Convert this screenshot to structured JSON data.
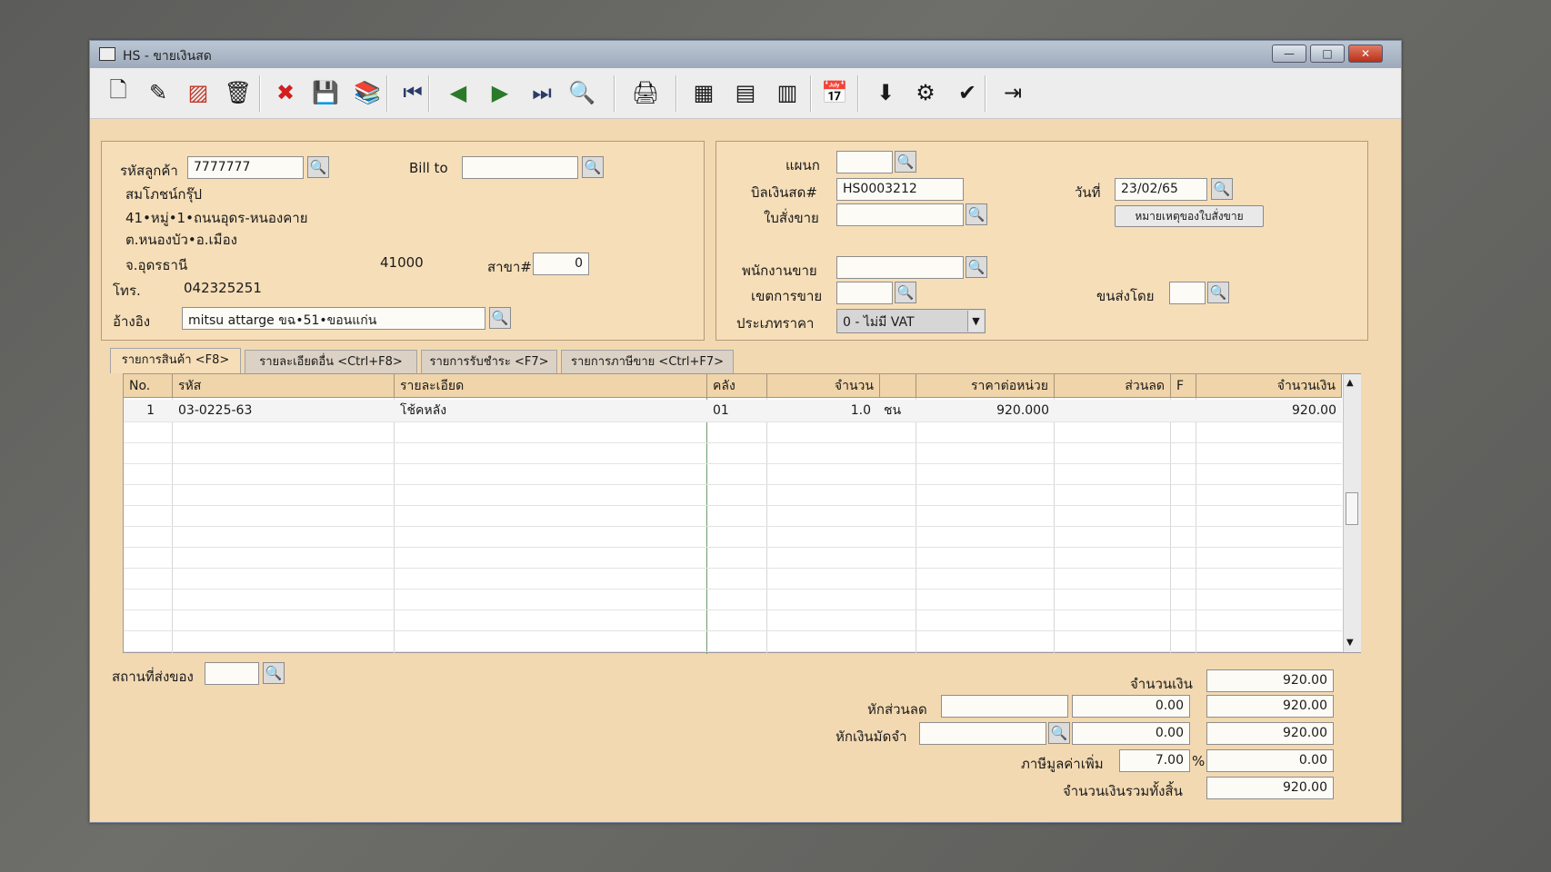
{
  "window": {
    "title": "HS - ขายเงินสด",
    "min": "—",
    "max": "□",
    "close": "✕"
  },
  "toolbar": [
    {
      "name": "new-doc-icon",
      "glyph": "🗋"
    },
    {
      "name": "edit-icon",
      "glyph": "✎"
    },
    {
      "name": "void-icon",
      "glyph": "▨"
    },
    {
      "name": "delete-bin-icon",
      "glyph": "🗑"
    },
    {
      "name": "cancel-icon",
      "glyph": "✖"
    },
    {
      "name": "save-icon",
      "glyph": "💾"
    },
    {
      "name": "books-icon",
      "glyph": "📚"
    },
    {
      "name": "first-record-icon",
      "glyph": "⏮"
    },
    {
      "name": "prev-record-icon",
      "glyph": "◀"
    },
    {
      "name": "next-record-icon",
      "glyph": "▶"
    },
    {
      "name": "last-record-icon",
      "glyph": "⏭"
    },
    {
      "name": "search-doc-icon",
      "glyph": "🔍"
    },
    {
      "name": "print-icon",
      "glyph": "🖨"
    },
    {
      "name": "report1-icon",
      "glyph": "▦"
    },
    {
      "name": "report2-icon",
      "glyph": "▤"
    },
    {
      "name": "report3-icon",
      "glyph": "▥"
    },
    {
      "name": "calendar-icon",
      "glyph": "📅"
    },
    {
      "name": "approve-ok-icon",
      "glyph": "⬇"
    },
    {
      "name": "tools-icon",
      "glyph": "⚙"
    },
    {
      "name": "ok-icon",
      "glyph": "✔"
    },
    {
      "name": "exit-icon",
      "glyph": "⇥"
    }
  ],
  "customer": {
    "code_label": "รหัสลูกค้า",
    "code": "7777777",
    "bill_to_label": "Bill to",
    "bill_to": "",
    "name": "สมโภชน์กรุ๊ป",
    "addr1": "41•หมู่•1•ถนนอุดร-หนองคาย",
    "addr2": "ต.หนองบัว•อ.เมือง",
    "addr3": "จ.อุดรธานี",
    "zip": "41000",
    "branch_label": "สาขา#",
    "branch": "0",
    "tel_label": "โทร.",
    "tel": "042325251",
    "ref_label": "อ้างอิง",
    "ref": "mitsu attarge ขฉ•51•ขอนแก่น"
  },
  "doc": {
    "dept_label": "แผนก",
    "dept": "",
    "bill_label": "บิลเงินสด#",
    "bill_no": "HS0003212",
    "date_label": "วันที่",
    "date": "23/02/65",
    "so_label": "ใบสั่งขาย",
    "so": "",
    "so_note_btn": "หมายเหตุของใบสั่งขาย",
    "salesman_label": "พนักงานขาย",
    "salesman": "",
    "area_label": "เขตการขาย",
    "area": "",
    "ship_by_label": "ขนส่งโดย",
    "ship_by": "",
    "price_type_label": "ประเภทราคา",
    "price_type": "0 - ไม่มี VAT"
  },
  "tabs": [
    "รายการสินค้า <F8>",
    "รายละเอียดอื่น <Ctrl+F8>",
    "รายการรับชำระ <F7>",
    "รายการภาษีขาย <Ctrl+F7>"
  ],
  "grid": {
    "headers": [
      "No.",
      "รหัส",
      "รายละเอียด",
      "คลัง",
      "จำนวน",
      "",
      "ราคาต่อหน่วย",
      "ส่วนลด",
      "F",
      "จำนวนเงิน"
    ],
    "rows": [
      {
        "no": "1",
        "code": "03-0225-63",
        "desc": "โช้คหลัง",
        "wh": "01",
        "qty": "1.0",
        "unit": "ชน",
        "price": "920.000",
        "disc": "",
        "f": "",
        "amount": "920.00"
      }
    ]
  },
  "footer": {
    "ship_place_label": "สถานที่ส่งของ",
    "ship_place": "",
    "amount_label": "จำนวนเงิน",
    "amount": "920.00",
    "discount_label": "หักส่วนลด",
    "discount_text": "",
    "discount_val": "0.00",
    "after_discount": "920.00",
    "deposit_label": "หักเงินมัดจำ",
    "deposit_text": "",
    "deposit_val": "0.00",
    "after_deposit": "920.00",
    "vat_label": "ภาษีมูลค่าเพิ่ม",
    "vat_rate": "7.00",
    "vat_pct": "%",
    "vat_amount": "0.00",
    "total_label": "จำนวนเงินรวมทั้งสิ้น",
    "total": "920.00"
  }
}
